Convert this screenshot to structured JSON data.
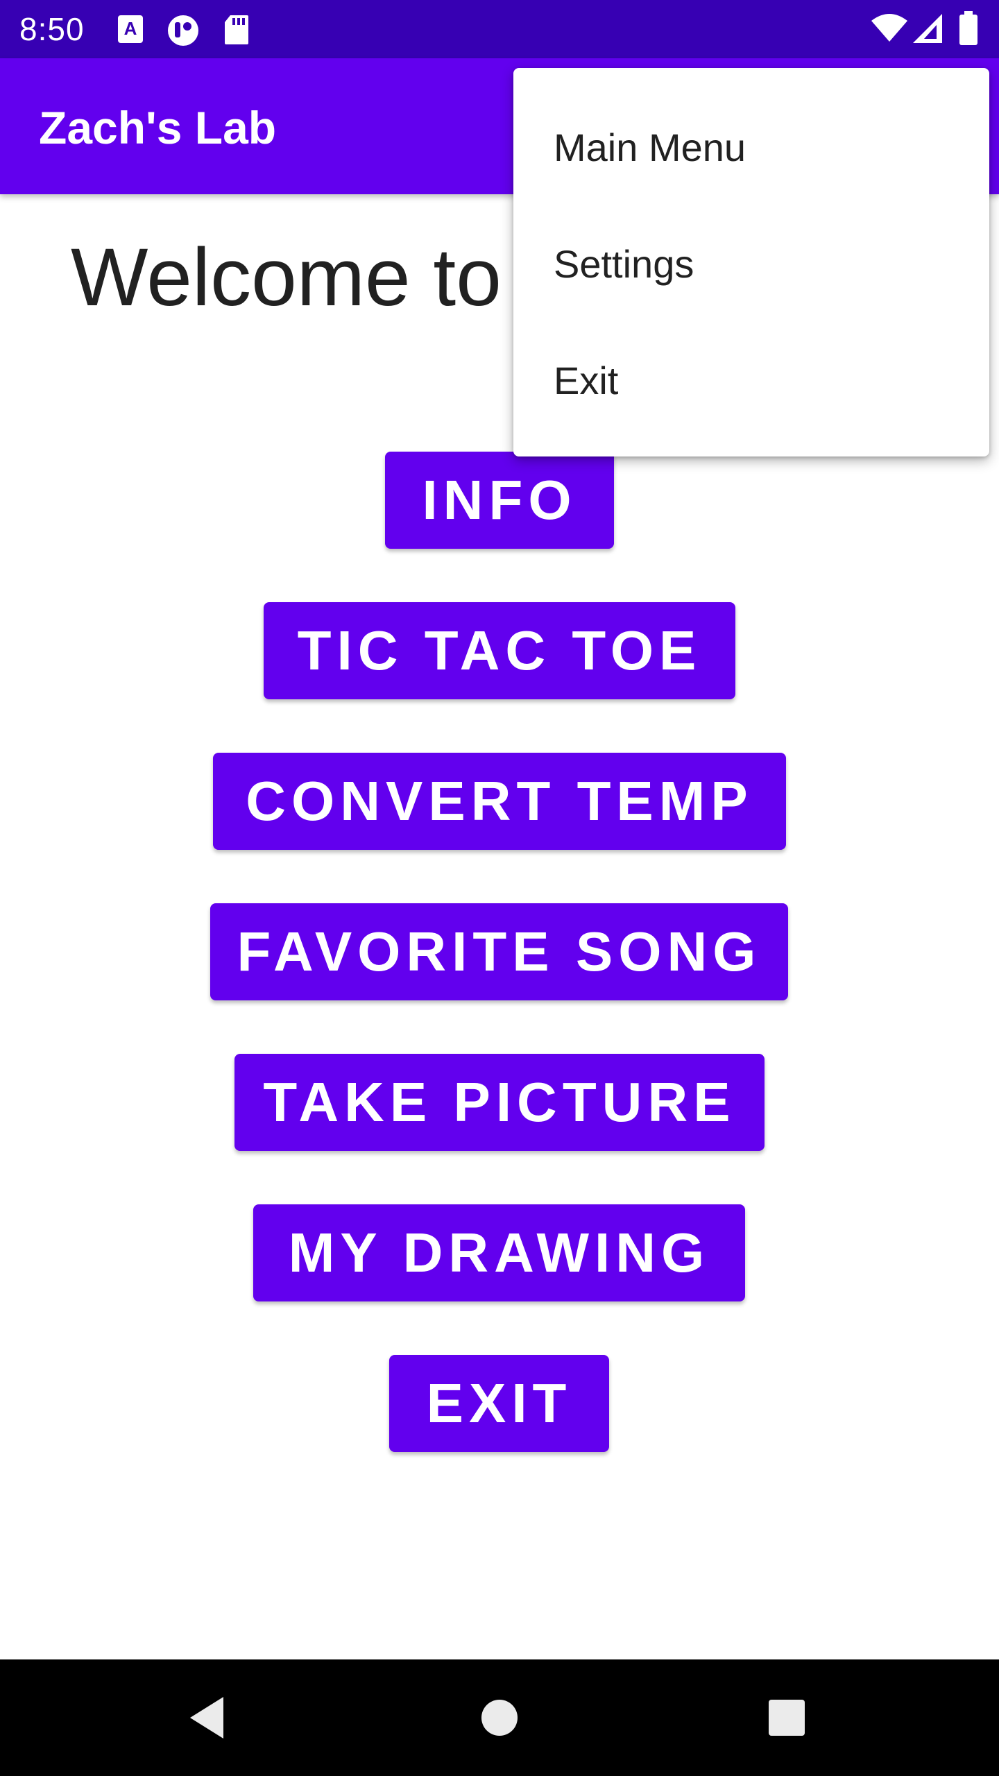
{
  "status_bar": {
    "time": "8:50",
    "icons": [
      "accessibility-a-icon",
      "record-icon",
      "sd-card-icon",
      "wifi-icon",
      "signal-icon",
      "battery-icon"
    ]
  },
  "app_bar": {
    "title": "Zach's Lab"
  },
  "main": {
    "welcome_text": "Welcome to",
    "buttons": [
      "INFO",
      "TIC TAC TOE",
      "CONVERT TEMP",
      "FAVORITE SONG",
      "TAKE PICTURE",
      "MY DRAWING",
      "EXIT"
    ]
  },
  "overflow_menu": {
    "items": [
      "Main Menu",
      "Settings",
      "Exit"
    ]
  },
  "nav_bar": {
    "icons": [
      "back-icon",
      "home-icon",
      "recents-icon"
    ]
  },
  "colors": {
    "status_bar": "#3700b3",
    "primary": "#6200ee",
    "text": "#212121",
    "nav_bar": "#000000"
  }
}
